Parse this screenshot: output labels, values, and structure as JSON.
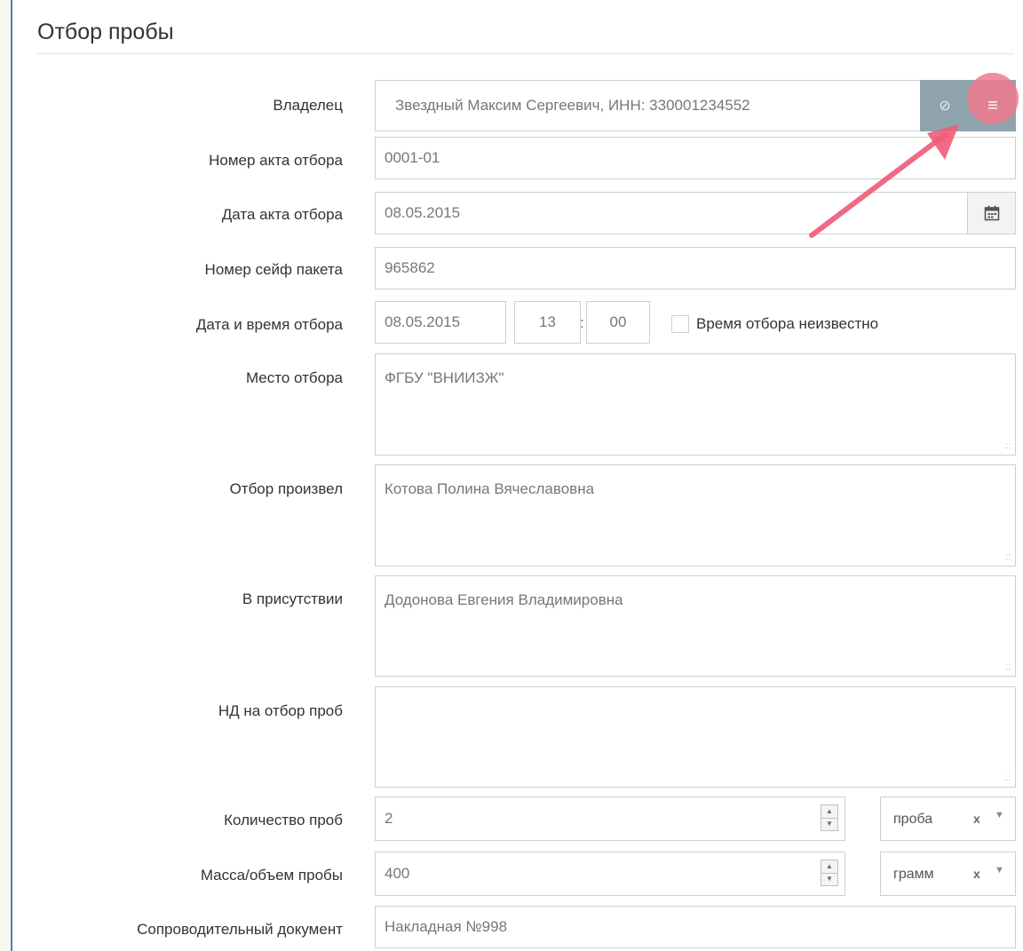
{
  "form": {
    "title": "Отбор пробы",
    "owner": {
      "label": "Владелец",
      "value": "Звездный Максим Сергеевич, ИНН: 330001234552"
    },
    "act_number": {
      "label": "Номер акта отбора",
      "value": "0001-01"
    },
    "act_date": {
      "label": "Дата акта отбора",
      "value": "08.05.2015"
    },
    "safe_package": {
      "label": "Номер сейф пакета",
      "value": "965862"
    },
    "sampling_datetime": {
      "label": "Дата и время отбора",
      "date": "08.05.2015",
      "hour": "13",
      "separator": ":",
      "minute": "00",
      "unknown_label": "Время отбора неизвестно"
    },
    "place": {
      "label": "Место отбора",
      "value": "ФГБУ \"ВНИИЗЖ\""
    },
    "performed_by": {
      "label": "Отбор произвел",
      "value": "Котова Полина Вячеславовна"
    },
    "witness": {
      "label": "В присутствии",
      "value": "Додонова Евгения Владимировна"
    },
    "nd": {
      "label": "НД на отбор проб",
      "value": ""
    },
    "sample_count": {
      "label": "Количество проб",
      "value": "2",
      "unit": "проба"
    },
    "mass": {
      "label": "Масса/объем пробы",
      "value": "400",
      "unit": "грамм"
    },
    "document": {
      "label": "Сопроводительный документ",
      "value": "Накладная №998"
    }
  },
  "icons": {
    "clear": "⊘",
    "menu": "≡",
    "calendar": "calendar-icon",
    "spin_up": "▲",
    "spin_down": "▼",
    "select_clear": "x",
    "select_caret": "▼",
    "resize_grip": ".::"
  },
  "colors": {
    "accent": "#4a7fb5",
    "addon_gray": "#8fa3ad",
    "highlight": "#f07a8e",
    "arrow": "#ee5c78"
  }
}
